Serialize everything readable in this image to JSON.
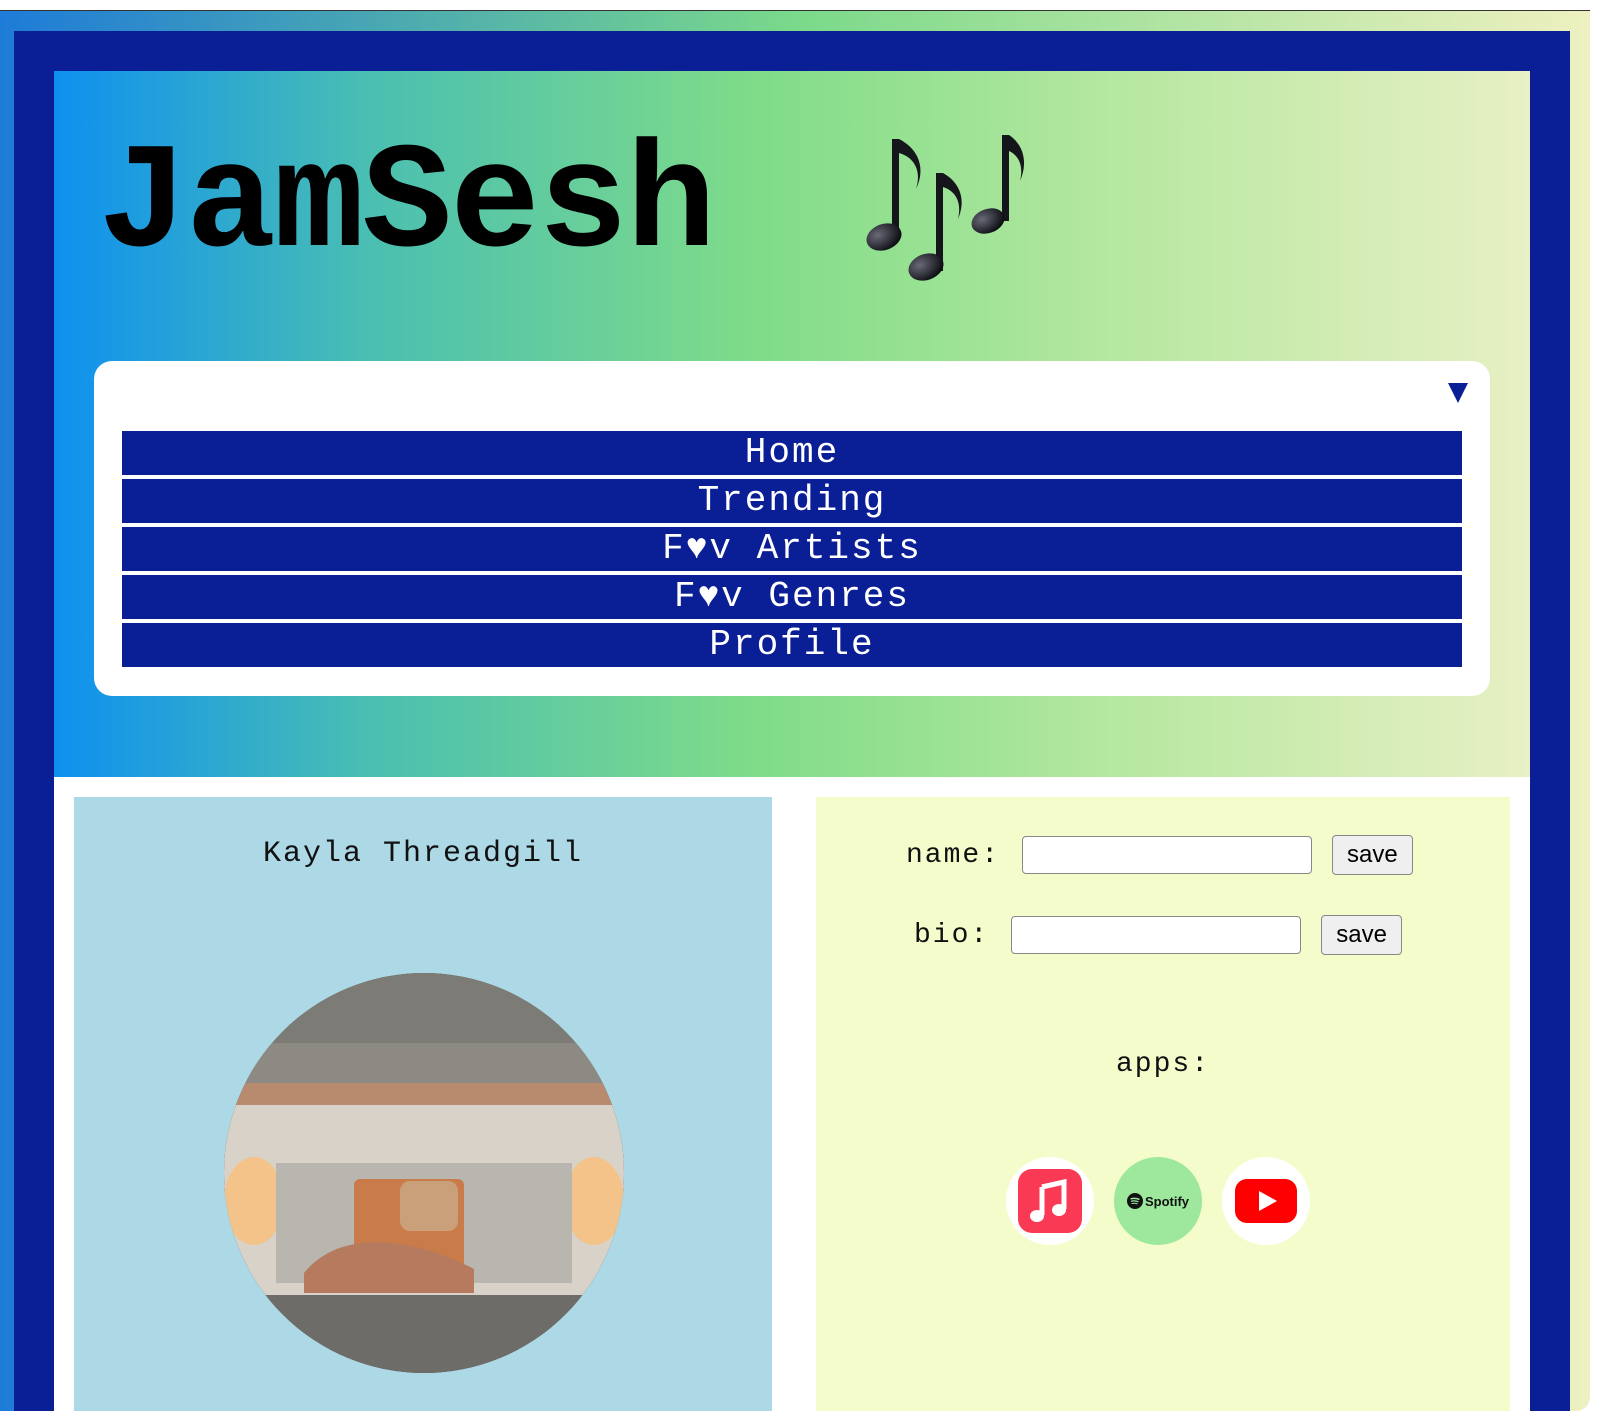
{
  "app": {
    "title": "JamSesh",
    "title_emoji": "music-notes"
  },
  "nav": {
    "toggle_symbol": "▼",
    "items": [
      {
        "label": "Home"
      },
      {
        "label": "Trending"
      },
      {
        "label": "F♥v Artists"
      },
      {
        "label": "F♥v Genres"
      },
      {
        "label": "Profile"
      }
    ]
  },
  "profile": {
    "name": "Kayla Threadgill",
    "avatar": "profile-photo"
  },
  "form": {
    "name_label": "name:",
    "name_value": "",
    "bio_label": "bio:",
    "bio_value": "",
    "save_label": "save"
  },
  "apps": {
    "label": "apps:",
    "items": [
      {
        "name": "apple-music-icon"
      },
      {
        "name": "spotify-icon",
        "text": "Spotify"
      },
      {
        "name": "youtube-icon"
      }
    ]
  },
  "colors": {
    "frame": "#0a1e96",
    "left_panel": "#add8e6",
    "right_panel": "#f5fccb"
  }
}
